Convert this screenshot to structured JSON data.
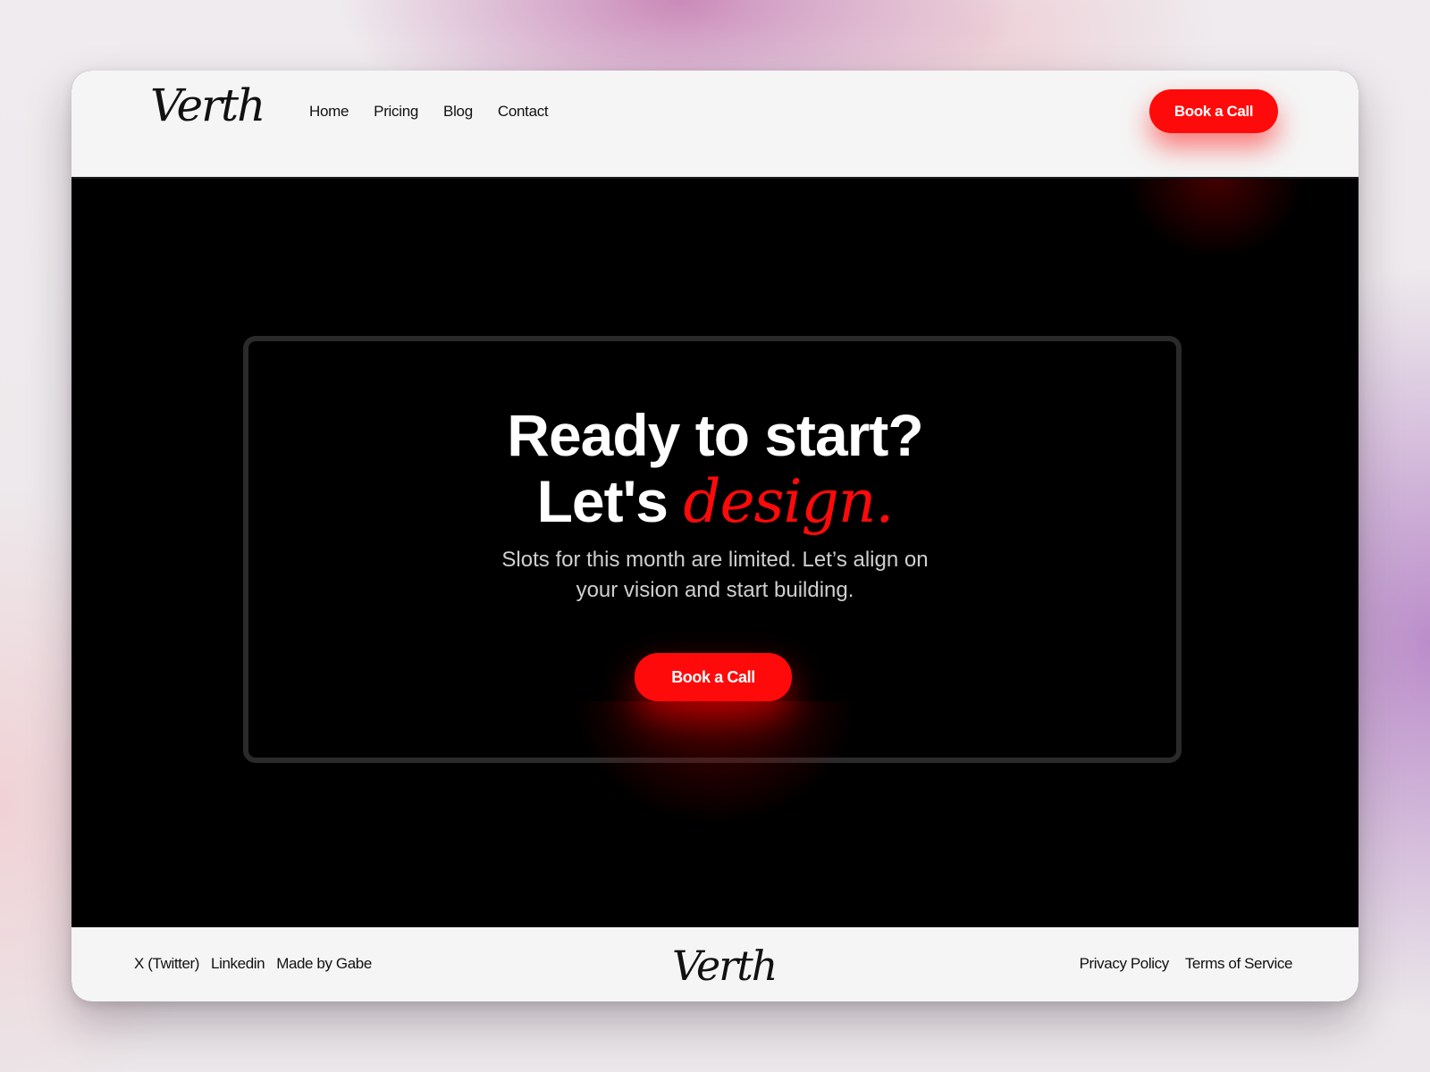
{
  "brand": {
    "logo_text": "Verth",
    "accent_color": "#ff0a0a"
  },
  "nav": {
    "items": [
      {
        "label": "Home"
      },
      {
        "label": "Pricing"
      },
      {
        "label": "Blog"
      },
      {
        "label": "Contact"
      }
    ],
    "cta_label": "Book a Call"
  },
  "hero": {
    "title_line1": "Ready to start?",
    "title_line2_prefix": "Let's ",
    "title_line2_accent": "design.",
    "subtitle_line1": "Slots for this month are limited. Let’s align on",
    "subtitle_line2": "your vision and start building.",
    "cta_label": "Book a Call"
  },
  "footer": {
    "left_links": [
      {
        "label": "X (Twitter)"
      },
      {
        "label": "Linkedin"
      },
      {
        "label": "Made by Gabe"
      }
    ],
    "logo_text": "Verth",
    "right_links": [
      {
        "label": "Privacy Policy"
      },
      {
        "label": "Terms of Service"
      }
    ]
  }
}
